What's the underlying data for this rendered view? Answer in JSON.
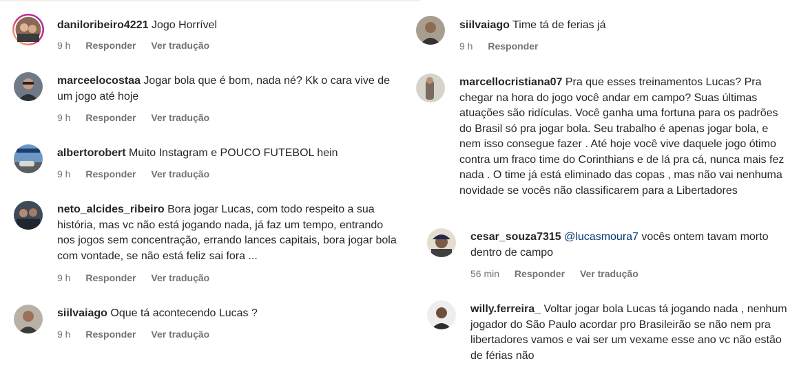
{
  "comments_left": [
    {
      "username": "daniloribeiro4221",
      "text": "Jogo Horrível",
      "time": "9 h",
      "reply": "Responder",
      "translate": "Ver tradução"
    },
    {
      "username": "marceelocostaa",
      "text": "Jogar bola que é bom, nada né? Kk o cara vive de um jogo até hoje",
      "time": "9 h",
      "reply": "Responder",
      "translate": "Ver tradução"
    },
    {
      "username": "albertorobert",
      "text": "Muito Instagram e POUCO FUTEBOL hein",
      "time": "9 h",
      "reply": "Responder",
      "translate": "Ver tradução"
    },
    {
      "username": "neto_alcides_ribeiro",
      "text": "Bora jogar Lucas, com todo respeito a sua história, mas vc não está jogando nada, já faz um tempo, entrando nos jogos sem concentração, errando lances capitais, bora jogar bola com vontade, se não está feliz sai fora ...",
      "time": "9 h",
      "reply": "Responder",
      "translate": "Ver tradução"
    },
    {
      "username": "siilvaiago",
      "text": "Oque tá acontecendo Lucas ?",
      "time": "9 h",
      "reply": "Responder",
      "translate": "Ver tradução"
    }
  ],
  "comments_right": [
    {
      "username": "siilvaiago",
      "text": "Time tá de ferias já",
      "time": "9 h",
      "reply": "Responder"
    },
    {
      "username": "marcellocristiana07",
      "text": "Pra que esses treinamentos Lucas? Pra chegar na hora do jogo você andar em campo? Suas últimas atuações são ridículas. Você ganha uma fortuna para os padrões do Brasil só pra jogar bola. Seu trabalho é apenas jogar bola, e nem isso consegue fazer . Até hoje você vive daquele jogo ótimo contra um fraco time do Corinthians e de lá pra cá, nunca mais fez nada . O time já está eliminado das copas , mas não vai nenhuma novidade se vocês não classificarem para a Libertadores"
    },
    {
      "username": "cesar_souza7315",
      "mention": "@lucasmoura7",
      "text": "vocês ontem tavam morto dentro de campo",
      "time": "56 min",
      "reply": "Responder",
      "translate": "Ver tradução"
    },
    {
      "username": "willy.ferreira_",
      "text": "Voltar jogar bola Lucas tá jogando nada , nenhum jogador do São Paulo acordar pro Brasileirão se não nem pra libertadores vamos e vai ser um vexame esse ano vc não estão de férias não"
    }
  ]
}
